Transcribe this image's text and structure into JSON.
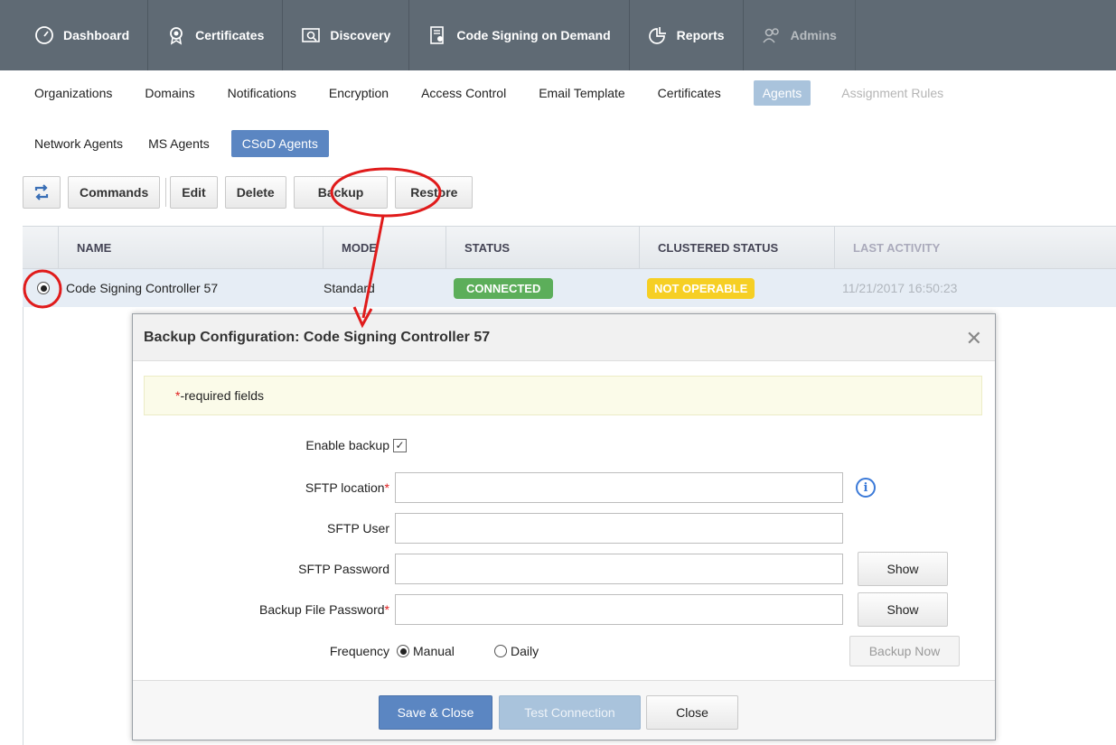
{
  "topnav": {
    "items": [
      {
        "label": "Dashboard",
        "icon": "dashboard-gauge-icon"
      },
      {
        "label": "Certificates",
        "icon": "certificate-badge-icon"
      },
      {
        "label": "Discovery",
        "icon": "discovery-icon"
      },
      {
        "label": "Code Signing on Demand",
        "icon": "code-signing-icon"
      },
      {
        "label": "Reports",
        "icon": "reports-chart-icon"
      },
      {
        "label": "Admins",
        "icon": "admins-users-icon"
      }
    ]
  },
  "settings_tabs": [
    {
      "label": "Organizations"
    },
    {
      "label": "Domains"
    },
    {
      "label": "Notifications"
    },
    {
      "label": "Encryption"
    },
    {
      "label": "Access Control"
    },
    {
      "label": "Email Template"
    },
    {
      "label": "Certificates"
    },
    {
      "label": "Agents"
    },
    {
      "label": "Assignment Rules"
    }
  ],
  "agent_tabs": [
    {
      "label": "Network Agents"
    },
    {
      "label": "MS Agents"
    },
    {
      "label": "CSoD Agents"
    }
  ],
  "toolbar": {
    "commands": "Commands",
    "edit": "Edit",
    "delete": "Delete",
    "backup": "Backup",
    "restore": "Restore"
  },
  "grid": {
    "headers": [
      "NAME",
      "MODE",
      "STATUS",
      "CLUSTERED STATUS",
      "LAST ACTIVITY"
    ],
    "rows": [
      {
        "name": "Code Signing Controller 57",
        "mode": "Standard",
        "status": "CONNECTED",
        "clustered_status": "NOT OPERABLE",
        "last_activity": "11/21/2017 16:50:23"
      }
    ]
  },
  "modal": {
    "title": "Backup Configuration: Code Signing Controller 57",
    "close_symbol": "✕",
    "required_star": "*",
    "required_text": "-required fields",
    "enable_backup_label": "Enable backup",
    "enable_backup_checked": true,
    "sftp_location_label": "SFTP location",
    "sftp_location_value": "",
    "sftp_user_label": "SFTP User",
    "sftp_user_value": "",
    "sftp_password_label": "SFTP Password",
    "sftp_password_value": "",
    "backup_file_password_label": "Backup File Password",
    "backup_file_password_value": "",
    "show_label": "Show",
    "frequency_label": "Frequency",
    "frequency_options": [
      "Manual",
      "Daily"
    ],
    "frequency_selected": "Manual",
    "backup_now_label": "Backup Now",
    "save_close_label": "Save & Close",
    "test_connection_label": "Test Connection",
    "close_label": "Close"
  },
  "colors": {
    "nav_bg": "#5f6a74",
    "primary": "#5b86c2",
    "connected": "#5cae5a",
    "not_operable": "#f6cf24",
    "annotation": "#e01b1b"
  }
}
